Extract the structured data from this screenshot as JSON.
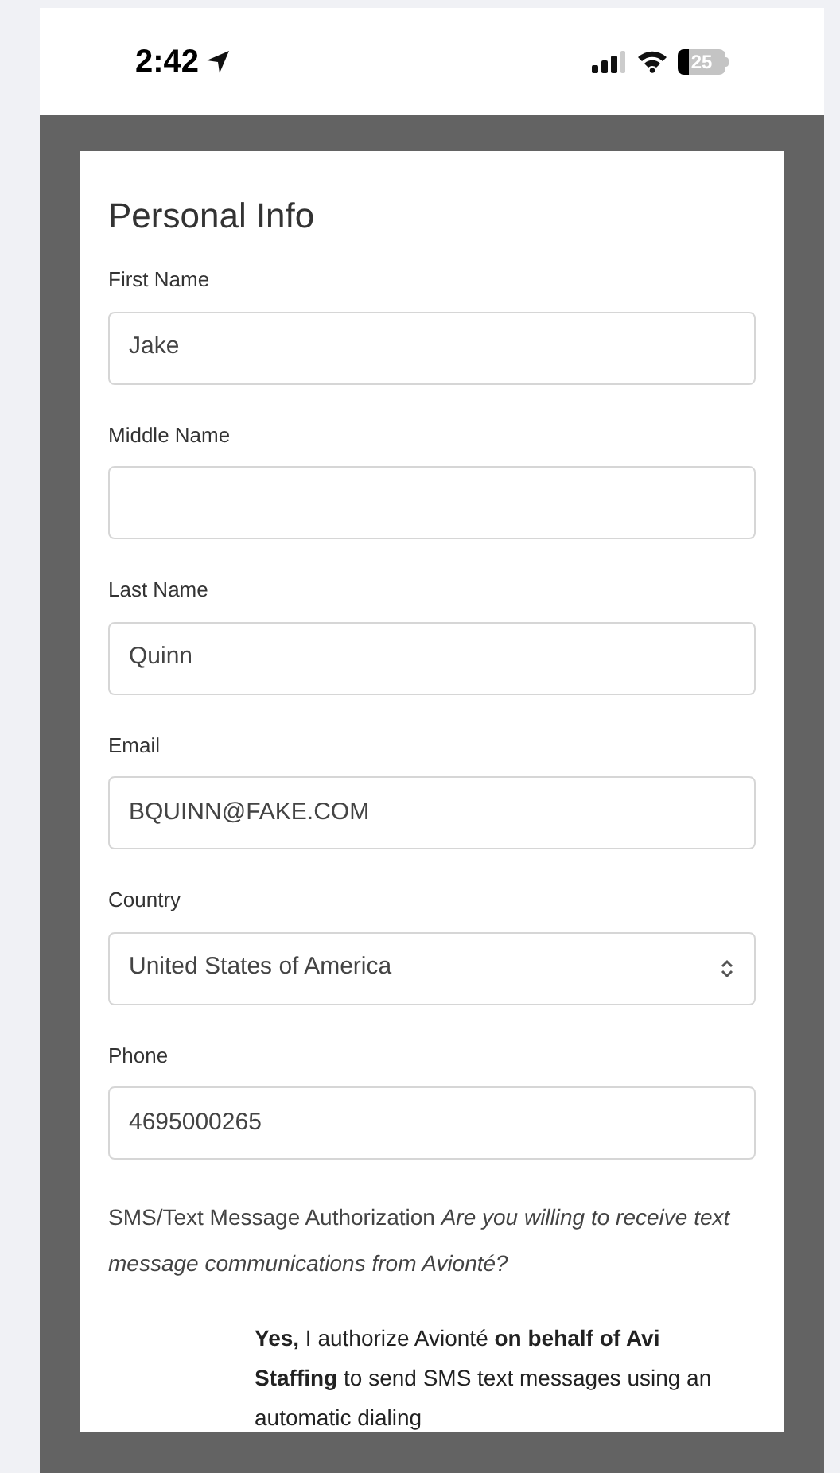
{
  "status_bar": {
    "time": "2:42",
    "battery": "25"
  },
  "form": {
    "title": "Personal Info",
    "fields": [
      {
        "label": "First Name",
        "kind": "text",
        "value": "Jake"
      },
      {
        "label": "Middle Name",
        "kind": "text"
      },
      {
        "label": "Last Name",
        "kind": "text",
        "value": "Quinn"
      },
      {
        "label": "Email",
        "kind": "text",
        "value": "BQUINN@FAKE.COM"
      },
      {
        "label": "Country",
        "kind": "select",
        "value": "United States of America"
      },
      {
        "label": "Phone",
        "kind": "text",
        "value": "4695000265"
      }
    ],
    "sms_authorization": "SMS/Text Message Authorization *Are you willing to receive text message communications from Avionté?*",
    "consent": "**Yes,** I authorize Avionté **on behalf of Avi Staffing** to send SMS text messages using an automatic dialing"
  }
}
